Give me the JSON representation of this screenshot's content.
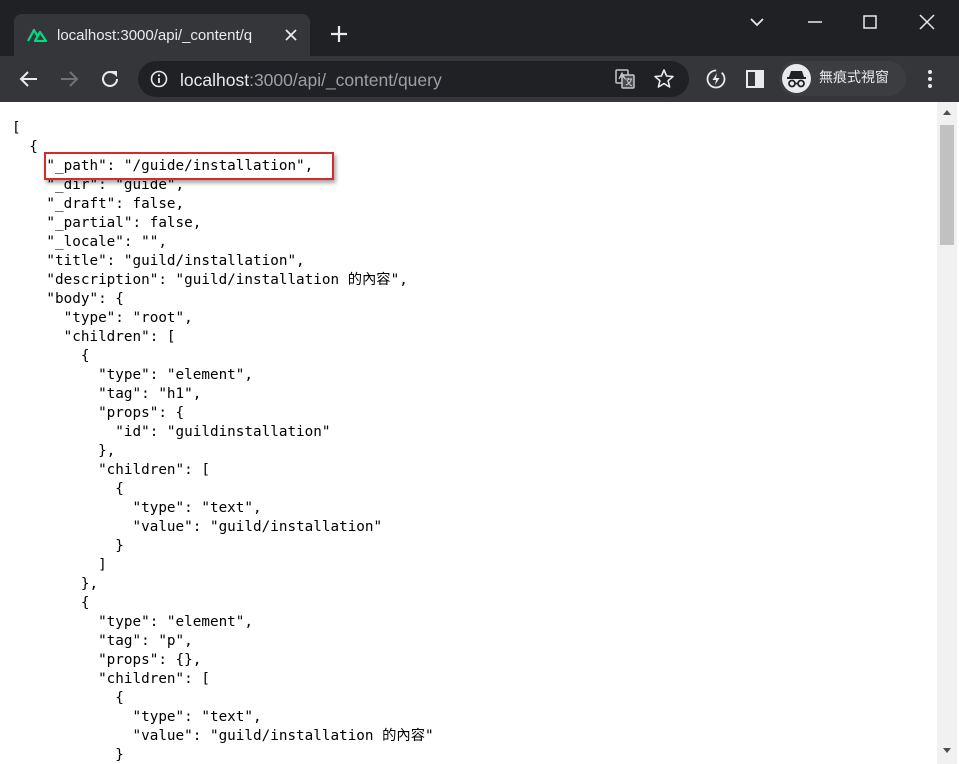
{
  "browser": {
    "tab": {
      "title": "localhost:3000/api/_content/q",
      "favicon": "nuxt-icon"
    },
    "address_bar": {
      "host": "localhost",
      "path": ":3000/api/_content/query"
    },
    "incognito_label": "無痕式視窗",
    "colors": {
      "frame": "#202124",
      "toolbar": "#35363a",
      "tab_active": "#35363a",
      "favicon": "#00dc82",
      "highlight": "#d22b2b"
    }
  },
  "document": {
    "lines": [
      "[",
      "  {",
      "    \"_path\": \"/guide/installation\",",
      "    \"_dir\": \"guide\",",
      "    \"_draft\": false,",
      "    \"_partial\": false,",
      "    \"_locale\": \"\",",
      "    \"title\": \"guild/installation\",",
      "    \"description\": \"guild/installation 的內容\",",
      "    \"body\": {",
      "      \"type\": \"root\",",
      "      \"children\": [",
      "        {",
      "          \"type\": \"element\",",
      "          \"tag\": \"h1\",",
      "          \"props\": {",
      "            \"id\": \"guildinstallation\"",
      "          },",
      "          \"children\": [",
      "            {",
      "              \"type\": \"text\",",
      "              \"value\": \"guild/installation\"",
      "            }",
      "          ]",
      "        },",
      "        {",
      "          \"type\": \"element\",",
      "          \"tag\": \"p\",",
      "          \"props\": {},",
      "          \"children\": [",
      "            {",
      "              \"type\": \"text\",",
      "              \"value\": \"guild/installation 的內容\"",
      "            }"
    ]
  }
}
